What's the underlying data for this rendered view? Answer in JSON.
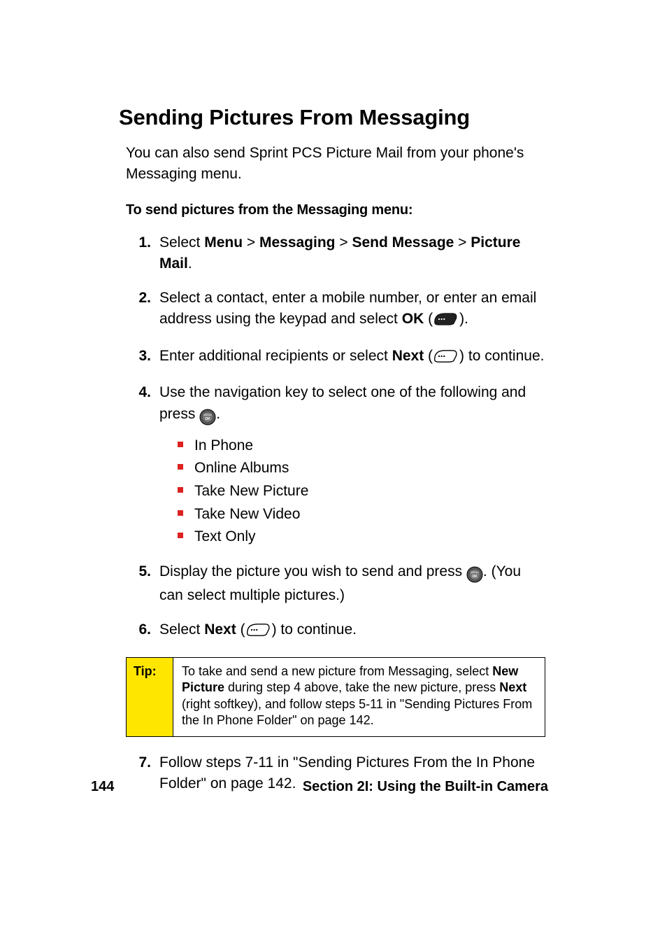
{
  "title": "Sending Pictures From Messaging",
  "intro": "You can also send Sprint PCS Picture Mail from your phone's Messaging menu.",
  "subhead": "To send pictures from the Messaging menu:",
  "steps": {
    "s1": {
      "num": "1.",
      "lead": "Select ",
      "b1": "Menu",
      "gt1": " > ",
      "b2": "Messaging",
      "gt2": " > ",
      "b3": "Send Message",
      "gt3": " > ",
      "b4": "Picture Mail",
      "tail": "."
    },
    "s2": {
      "num": "2.",
      "part1": "Select a contact, enter a mobile number, or enter an email address using the keypad and select ",
      "ok": "OK",
      "paren_open": " (",
      "paren_close": ")."
    },
    "s3": {
      "num": "3.",
      "part1": "Enter additional recipients or select ",
      "next": "Next",
      "paren_open": " (",
      "paren_close": ") to continue."
    },
    "s4": {
      "num": "4.",
      "part1": "Use the navigation key to select one of the following and press ",
      "tail": ".",
      "items": {
        "i1": "In Phone",
        "i2": "Online Albums",
        "i3": "Take New Picture",
        "i4": "Take New Video",
        "i5": "Text Only"
      }
    },
    "s5": {
      "num": "5.",
      "part1": "Display the picture you wish to send and press ",
      "part2": ". (You can select multiple pictures.)"
    },
    "s6": {
      "num": "6.",
      "part1": "Select ",
      "next": "Next",
      "paren_open": " (",
      "paren_close": ") to continue."
    },
    "s7": {
      "num": "7.",
      "text": "Follow steps 7-11 in \"Sending Pictures From the In Phone Folder\" on page 142."
    }
  },
  "tip": {
    "label": "Tip:",
    "t1": "To take and send a new picture from Messaging, select ",
    "b1": "New Picture",
    "t2": " during step 4 above, take the new picture, press ",
    "b2": "Next",
    "t3": " (right softkey), and follow steps 5-11 in \"Sending Pictures From the In Phone Folder\" on page 142."
  },
  "footer": {
    "page": "144",
    "section": "Section 2I: Using the Built-in Camera"
  }
}
